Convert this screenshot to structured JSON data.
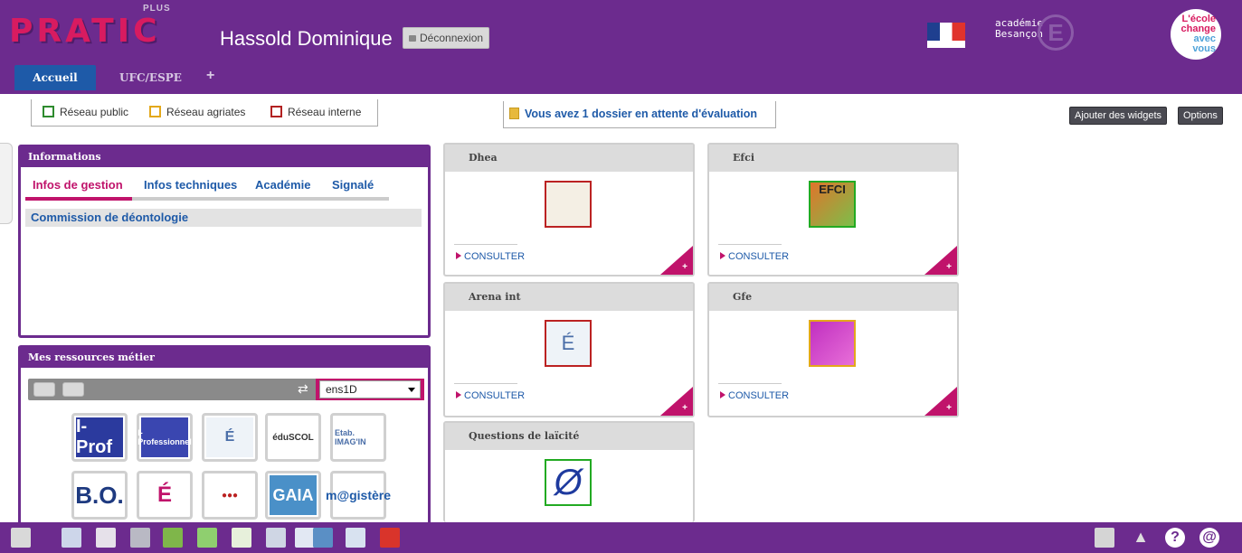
{
  "header": {
    "logo_text": "PRATIC",
    "logo_plus": "PLUS",
    "user_name": "Hassold Dominique",
    "logout_label": "Déconnexion",
    "academie_line1": "académie",
    "academie_line2": "Besançon",
    "ecole_line1": "L'école",
    "ecole_line2": "change",
    "ecole_line3": "avec",
    "ecole_line4": "vous"
  },
  "tabs": [
    {
      "label": "Accueil",
      "active": true
    },
    {
      "label": "UFC/ESPE",
      "active": false
    },
    {
      "label": "+",
      "active": false
    }
  ],
  "legend": {
    "items": [
      {
        "label": "Réseau public",
        "color": "#2e8b2e"
      },
      {
        "label": "Réseau agriates",
        "color": "#e3a81b"
      },
      {
        "label": "Réseau interne",
        "color": "#b22222"
      }
    ]
  },
  "alert": {
    "text": "Vous avez 1 dossier en attente d'évaluation"
  },
  "header_buttons": {
    "add_widgets": "Ajouter des widgets",
    "options": "Options"
  },
  "informations": {
    "title": "Informations",
    "tabs": [
      "Infos de gestion",
      "Infos techniques",
      "Académie",
      "Signalé"
    ],
    "rows": [
      "Commission de déontologie"
    ]
  },
  "ressources": {
    "title": "Mes ressources métier",
    "select_value": "ens1D",
    "items": [
      {
        "icon": "i-prof-icon",
        "label": "I-Prof"
      },
      {
        "icon": "i-professionnel-icon",
        "label": "I-Professionnel"
      },
      {
        "icon": "education-nationale-icon",
        "label": ""
      },
      {
        "icon": "eduscol-icon",
        "label": "éduSCOL"
      },
      {
        "icon": "etab-imagin-icon",
        "label": "Etab. IMAG'IN"
      },
      {
        "icon": "bo-icon",
        "label": "B.O."
      },
      {
        "icon": "marianne-e-icon",
        "label": "É"
      },
      {
        "icon": "ogo-icon",
        "label": ""
      },
      {
        "icon": "gaia-icon",
        "label": "GAIA"
      },
      {
        "icon": "magistere-icon",
        "label": "m@gistère"
      }
    ]
  },
  "widgets": [
    {
      "title": "Dhea",
      "link": "CONSULTER",
      "image": "key-icon",
      "border": "#b22222"
    },
    {
      "title": "Efci",
      "link": "CONSULTER",
      "image": "efci-icon",
      "badge": "EFCI",
      "border": "#2e8b2e"
    },
    {
      "title": "Arena int",
      "link": "CONSULTER",
      "image": "education-nationale-icon",
      "border": "#b22222"
    },
    {
      "title": "Gfe",
      "link": "CONSULTER",
      "image": "gfe-icon",
      "border": "#e3a81b"
    },
    {
      "title": "Questions de laïcité",
      "link": "",
      "image": "laicite-icon",
      "border": "#2e8b2e"
    }
  ],
  "colors": {
    "brand": "#6c2b8e",
    "accent": "#c0136b",
    "link": "#1e5aa8"
  }
}
